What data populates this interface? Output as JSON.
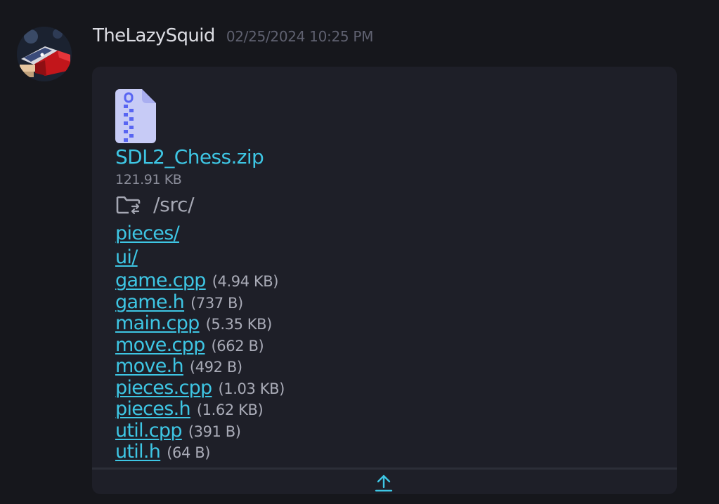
{
  "message": {
    "username": "TheLazySquid",
    "timestamp": "02/25/2024 10:25 PM",
    "avatar_icon": "avatar-image"
  },
  "attachment": {
    "icon": "zip-file-icon",
    "file_name": "SDL2_Chess.zip",
    "file_size": "121.91 KB",
    "folder_icon": "folder-switch-icon",
    "current_path": "/src/",
    "entries": [
      {
        "name": "pieces/",
        "size": ""
      },
      {
        "name": "ui/",
        "size": ""
      },
      {
        "name": "game.cpp",
        "size": "(4.94 KB)"
      },
      {
        "name": "game.h",
        "size": "(737 B)"
      },
      {
        "name": "main.cpp",
        "size": "(5.35 KB)"
      },
      {
        "name": "move.cpp",
        "size": "(662 B)"
      },
      {
        "name": "move.h",
        "size": "(492 B)"
      },
      {
        "name": "pieces.cpp",
        "size": "(1.03 KB)"
      },
      {
        "name": "pieces.h",
        "size": "(1.62 KB)"
      },
      {
        "name": "util.cpp",
        "size": "(391 B)"
      },
      {
        "name": "util.h",
        "size": "(64 B)"
      }
    ],
    "collapse_icon": "arrow-up-icon"
  },
  "colors": {
    "background": "#16171c",
    "card": "#1e1f28",
    "link": "#3ec6e4",
    "zip_icon": "#c7cbf6",
    "zipper": "#5865f2"
  }
}
